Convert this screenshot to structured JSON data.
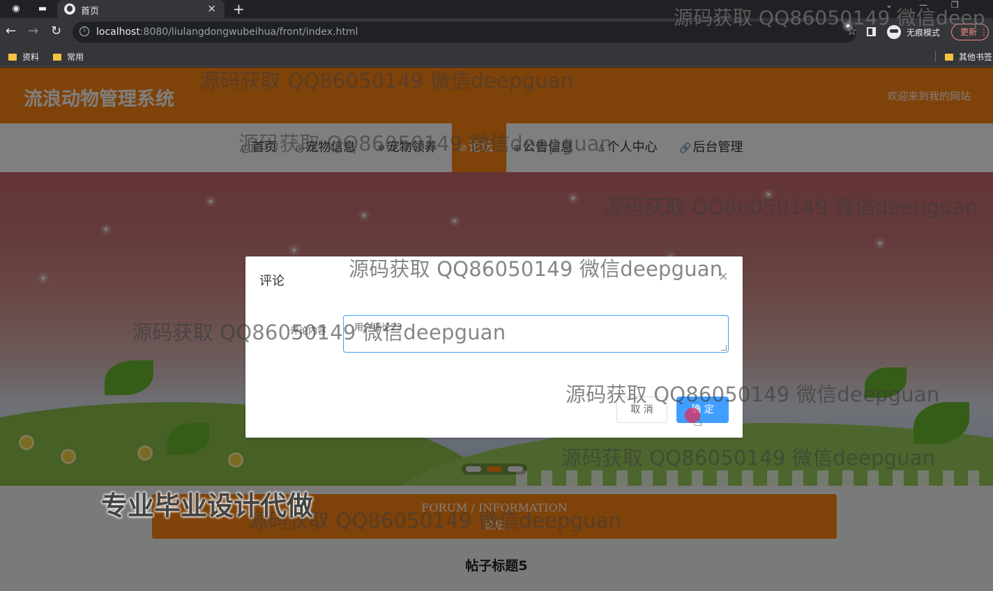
{
  "browser": {
    "tab_title": "首页",
    "url_host": "localhost",
    "url_path": ":8080/liulangdongwubeihua/front/index.html",
    "incognito_label": "无痕模式",
    "update_label": "更新",
    "bookmarks": [
      "资料",
      "常用"
    ],
    "other_bookmarks": "其他书签"
  },
  "site": {
    "title": "流浪动物管理系统",
    "welcome": "欢迎来到我的网站",
    "nav": [
      {
        "icon": "▢",
        "label": "首页"
      },
      {
        "icon": "◎",
        "label": "宠物信息"
      },
      {
        "icon": "❄",
        "label": "宠物领养"
      },
      {
        "icon": "⊘",
        "label": "论坛",
        "active": true
      },
      {
        "icon": "⊕",
        "label": "公告信息"
      },
      {
        "icon": "♙",
        "label": "个人中心"
      },
      {
        "icon": "🔗",
        "label": "后台管理"
      }
    ],
    "section_en": "FORUM / INFORMATION",
    "section_cn": "论坛",
    "post_title": "帖子标题5"
  },
  "dialog": {
    "title": "评论",
    "close": "×",
    "field_label": "评论内容",
    "field_value": "用户评论23",
    "cancel_label": "取 消",
    "confirm_label": "确 定"
  },
  "watermarks": {
    "text": "源码获取 QQ86050149 微信deepguan",
    "tab_text": "源码获取 QQ86050149 微信deep",
    "promo": "专业毕业设计代做"
  },
  "colors": {
    "brand_orange": "#ff8513",
    "primary_blue": "#409eff"
  }
}
